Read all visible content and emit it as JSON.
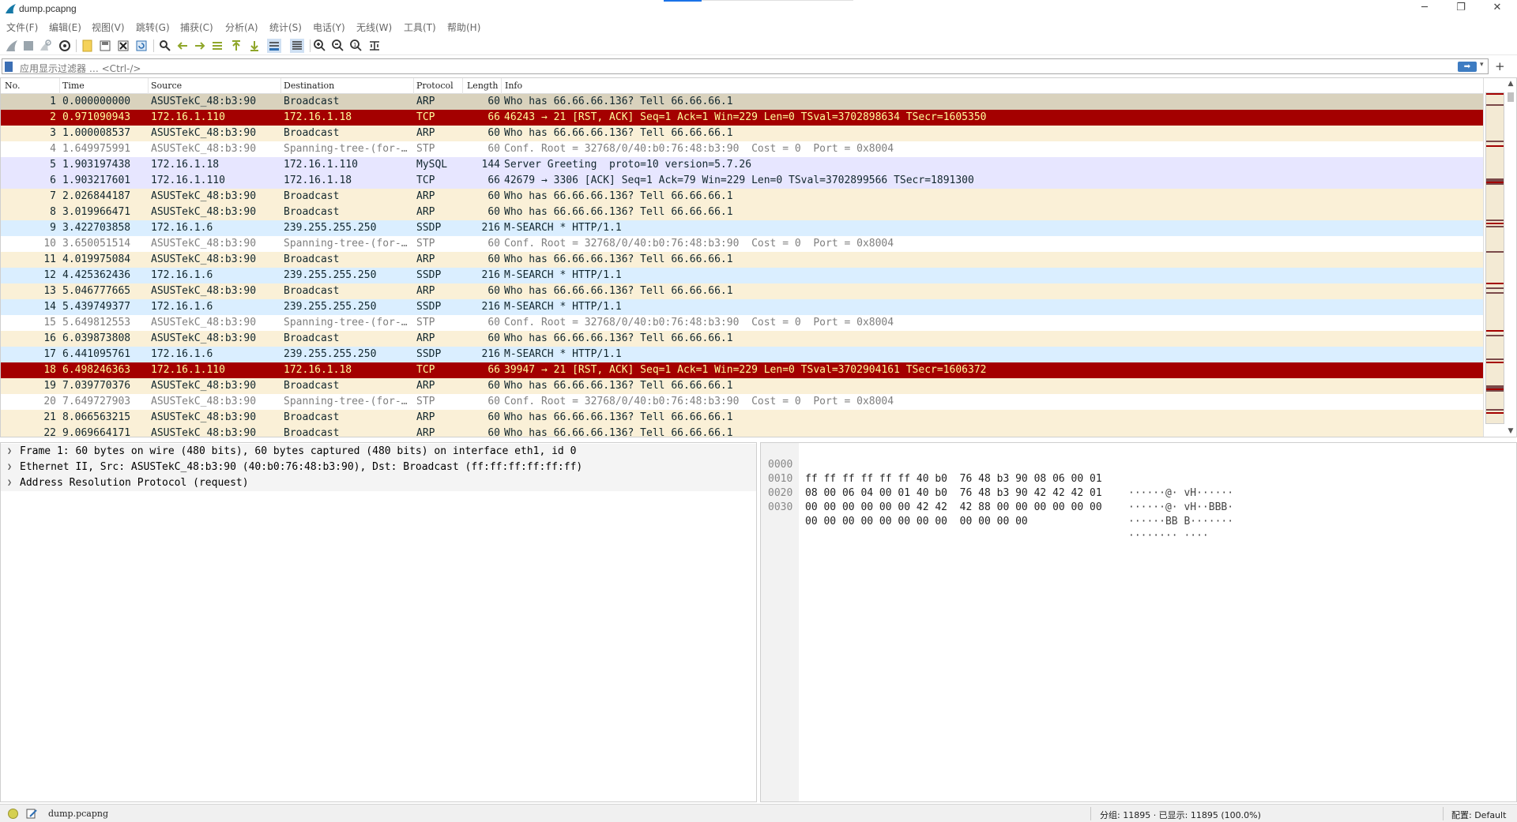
{
  "window": {
    "title": "dump.pcapng",
    "minimize": "─",
    "restore": "❐",
    "close": "✕"
  },
  "menu": [
    "文件(F)",
    "编辑(E)",
    "视图(V)",
    "跳转(G)",
    "捕获(C)",
    "分析(A)",
    "统计(S)",
    "电话(Y)",
    "无线(W)",
    "工具(T)",
    "帮助(H)"
  ],
  "toolbar": {
    "icons": [
      "shark-fin-start-icon",
      "stop-icon",
      "restart-icon",
      "capture-options-icon",
      "open-file-icon",
      "save-file-icon",
      "close-file-icon",
      "reload-icon",
      "find-packet-icon",
      "go-back-icon",
      "go-forward-icon",
      "go-to-packet-icon",
      "first-packet-icon",
      "last-packet-icon",
      "auto-scroll-icon",
      "colorize-icon",
      "zoom-in-icon",
      "zoom-out-icon",
      "zoom-normal-icon",
      "resize-columns-icon"
    ]
  },
  "filter": {
    "placeholder": "应用显示过滤器 … <Ctrl-/>",
    "apply_label": "➡",
    "dropdown": "▾",
    "add_label": "+"
  },
  "packet_list": {
    "columns": [
      "No.",
      "Time",
      "Source",
      "Destination",
      "Protocol",
      "Length",
      "Info"
    ],
    "rows": [
      {
        "no": "1",
        "time": "0.000000000",
        "src": "ASUSTekC_48:b3:90",
        "dst": "Broadcast",
        "proto": "ARP",
        "len": "60",
        "info": "Who has 66.66.66.136? Tell 66.66.66.1",
        "bg": "#d9d2bd",
        "fg": "#12272e"
      },
      {
        "no": "2",
        "time": "0.971090943",
        "src": "172.16.1.110",
        "dst": "172.16.1.18",
        "proto": "TCP",
        "len": "66",
        "info": "46243 → 21 [RST, ACK] Seq=1 Ack=1 Win=229 Len=0 TSval=3702898634 TSecr=1605350",
        "bg": "#a40000",
        "fg": "#fffc9c"
      },
      {
        "no": "3",
        "time": "1.000008537",
        "src": "ASUSTekC_48:b3:90",
        "dst": "Broadcast",
        "proto": "ARP",
        "len": "60",
        "info": "Who has 66.66.66.136? Tell 66.66.66.1",
        "bg": "#faf0d7",
        "fg": "#12272e"
      },
      {
        "no": "4",
        "time": "1.649975991",
        "src": "ASUSTekC_48:b3:90",
        "dst": "Spanning-tree-(for-…",
        "proto": "STP",
        "len": "60",
        "info": "Conf. Root = 32768/0/40:b0:76:48:b3:90  Cost = 0  Port = 0x8004",
        "bg": "#ffffff",
        "fg": "#7f7f7f"
      },
      {
        "no": "5",
        "time": "1.903197438",
        "src": "172.16.1.18",
        "dst": "172.16.1.110",
        "proto": "MySQL",
        "len": "144",
        "info": "Server Greeting  proto=10 version=5.7.26",
        "bg": "#e7e6ff",
        "fg": "#12272e"
      },
      {
        "no": "6",
        "time": "1.903217601",
        "src": "172.16.1.110",
        "dst": "172.16.1.18",
        "proto": "TCP",
        "len": "66",
        "info": "42679 → 3306 [ACK] Seq=1 Ack=79 Win=229 Len=0 TSval=3702899566 TSecr=1891300",
        "bg": "#e7e6ff",
        "fg": "#12272e"
      },
      {
        "no": "7",
        "time": "2.026844187",
        "src": "ASUSTekC_48:b3:90",
        "dst": "Broadcast",
        "proto": "ARP",
        "len": "60",
        "info": "Who has 66.66.66.136? Tell 66.66.66.1",
        "bg": "#faf0d7",
        "fg": "#12272e"
      },
      {
        "no": "8",
        "time": "3.019966471",
        "src": "ASUSTekC_48:b3:90",
        "dst": "Broadcast",
        "proto": "ARP",
        "len": "60",
        "info": "Who has 66.66.66.136? Tell 66.66.66.1",
        "bg": "#faf0d7",
        "fg": "#12272e"
      },
      {
        "no": "9",
        "time": "3.422703858",
        "src": "172.16.1.6",
        "dst": "239.255.255.250",
        "proto": "SSDP",
        "len": "216",
        "info": "M-SEARCH * HTTP/1.1",
        "bg": "#daeeff",
        "fg": "#12272e"
      },
      {
        "no": "10",
        "time": "3.650051514",
        "src": "ASUSTekC_48:b3:90",
        "dst": "Spanning-tree-(for-…",
        "proto": "STP",
        "len": "60",
        "info": "Conf. Root = 32768/0/40:b0:76:48:b3:90  Cost = 0  Port = 0x8004",
        "bg": "#ffffff",
        "fg": "#7f7f7f"
      },
      {
        "no": "11",
        "time": "4.019975084",
        "src": "ASUSTekC_48:b3:90",
        "dst": "Broadcast",
        "proto": "ARP",
        "len": "60",
        "info": "Who has 66.66.66.136? Tell 66.66.66.1",
        "bg": "#faf0d7",
        "fg": "#12272e"
      },
      {
        "no": "12",
        "time": "4.425362436",
        "src": "172.16.1.6",
        "dst": "239.255.255.250",
        "proto": "SSDP",
        "len": "216",
        "info": "M-SEARCH * HTTP/1.1",
        "bg": "#daeeff",
        "fg": "#12272e"
      },
      {
        "no": "13",
        "time": "5.046777665",
        "src": "ASUSTekC_48:b3:90",
        "dst": "Broadcast",
        "proto": "ARP",
        "len": "60",
        "info": "Who has 66.66.66.136? Tell 66.66.66.1",
        "bg": "#faf0d7",
        "fg": "#12272e"
      },
      {
        "no": "14",
        "time": "5.439749377",
        "src": "172.16.1.6",
        "dst": "239.255.255.250",
        "proto": "SSDP",
        "len": "216",
        "info": "M-SEARCH * HTTP/1.1",
        "bg": "#daeeff",
        "fg": "#12272e"
      },
      {
        "no": "15",
        "time": "5.649812553",
        "src": "ASUSTekC_48:b3:90",
        "dst": "Spanning-tree-(for-…",
        "proto": "STP",
        "len": "60",
        "info": "Conf. Root = 32768/0/40:b0:76:48:b3:90  Cost = 0  Port = 0x8004",
        "bg": "#ffffff",
        "fg": "#7f7f7f"
      },
      {
        "no": "16",
        "time": "6.039873808",
        "src": "ASUSTekC_48:b3:90",
        "dst": "Broadcast",
        "proto": "ARP",
        "len": "60",
        "info": "Who has 66.66.66.136? Tell 66.66.66.1",
        "bg": "#faf0d7",
        "fg": "#12272e"
      },
      {
        "no": "17",
        "time": "6.441095761",
        "src": "172.16.1.6",
        "dst": "239.255.255.250",
        "proto": "SSDP",
        "len": "216",
        "info": "M-SEARCH * HTTP/1.1",
        "bg": "#daeeff",
        "fg": "#12272e"
      },
      {
        "no": "18",
        "time": "6.498246363",
        "src": "172.16.1.110",
        "dst": "172.16.1.18",
        "proto": "TCP",
        "len": "66",
        "info": "39947 → 21 [RST, ACK] Seq=1 Ack=1 Win=229 Len=0 TSval=3702904161 TSecr=1606372",
        "bg": "#a40000",
        "fg": "#fffc9c"
      },
      {
        "no": "19",
        "time": "7.039770376",
        "src": "ASUSTekC_48:b3:90",
        "dst": "Broadcast",
        "proto": "ARP",
        "len": "60",
        "info": "Who has 66.66.66.136? Tell 66.66.66.1",
        "bg": "#faf0d7",
        "fg": "#12272e"
      },
      {
        "no": "20",
        "time": "7.649727903",
        "src": "ASUSTekC_48:b3:90",
        "dst": "Spanning-tree-(for-…",
        "proto": "STP",
        "len": "60",
        "info": "Conf. Root = 32768/0/40:b0:76:48:b3:90  Cost = 0  Port = 0x8004",
        "bg": "#ffffff",
        "fg": "#7f7f7f"
      },
      {
        "no": "21",
        "time": "8.066563215",
        "src": "ASUSTekC_48:b3:90",
        "dst": "Broadcast",
        "proto": "ARP",
        "len": "60",
        "info": "Who has 66.66.66.136? Tell 66.66.66.1",
        "bg": "#faf0d7",
        "fg": "#12272e"
      },
      {
        "no": "22",
        "time": "9.069664171",
        "src": "ASUSTekC_48:b3:90",
        "dst": "Broadcast",
        "proto": "ARP",
        "len": "60",
        "info": "Who has 66.66.66.136? Tell 66.66.66.1",
        "bg": "#faf0d7",
        "fg": "#12272e"
      }
    ]
  },
  "details": [
    "Frame 1: 60 bytes on wire (480 bits), 60 bytes captured (480 bits) on interface eth1, id 0",
    "Ethernet II, Src: ASUSTekC_48:b3:90 (40:b0:76:48:b3:90), Dst: Broadcast (ff:ff:ff:ff:ff:ff)",
    "Address Resolution Protocol (request)"
  ],
  "bytes": [
    {
      "off": "0000",
      "hex": "ff ff ff ff ff ff 40 b0  76 48 b3 90 08 06 00 01",
      "ascii": "······@· vH······"
    },
    {
      "off": "0010",
      "hex": "08 00 06 04 00 01 40 b0  76 48 b3 90 42 42 42 01",
      "ascii": "······@· vH··BBB·"
    },
    {
      "off": "0020",
      "hex": "00 00 00 00 00 00 42 42  42 88 00 00 00 00 00 00",
      "ascii": "······BB B·······"
    },
    {
      "off": "0030",
      "hex": "00 00 00 00 00 00 00 00  00 00 00 00",
      "ascii": "········ ····"
    }
  ],
  "status": {
    "file": "dump.pcapng",
    "counts": "分组: 11895 · 已显示: 11895 (100.0%)",
    "profile": "配置: Default"
  }
}
